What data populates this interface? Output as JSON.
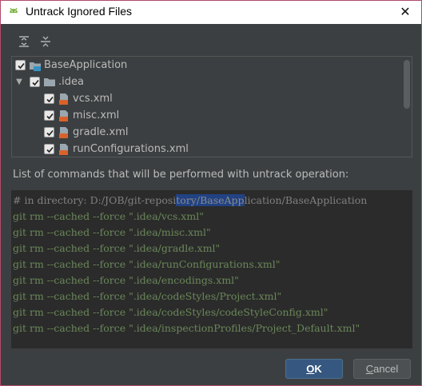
{
  "window": {
    "title": "Untrack Ignored Files",
    "close_glyph": "✕",
    "icon": "android-icon"
  },
  "toolbar": {
    "expand_all_icon": "expand-all-icon",
    "collapse_all_icon": "collapse-all-icon"
  },
  "tree": {
    "items": [
      {
        "label": "BaseApplication",
        "checked": true,
        "icon": "module-icon",
        "level": 0,
        "expanded": null
      },
      {
        "label": ".idea",
        "checked": true,
        "icon": "folder-icon",
        "level": 1,
        "expanded": true
      },
      {
        "label": "vcs.xml",
        "checked": true,
        "icon": "xml-file-icon",
        "level": 2,
        "expanded": null
      },
      {
        "label": "misc.xml",
        "checked": true,
        "icon": "xml-file-icon",
        "level": 2,
        "expanded": null
      },
      {
        "label": "gradle.xml",
        "checked": true,
        "icon": "xml-file-icon",
        "level": 2,
        "expanded": null
      },
      {
        "label": "runConfigurations.xml",
        "checked": true,
        "icon": "xml-file-icon",
        "level": 2,
        "expanded": null
      }
    ]
  },
  "commands": {
    "label": "List of commands that will be performed with untrack operation:",
    "comment_prefix": "# in directory: D:/JOB/git-reposi",
    "comment_highlight": "tory/BaseApp",
    "comment_suffix": "lication/BaseApplication",
    "lines": [
      "git rm --cached --force \".idea/vcs.xml\"",
      "git rm --cached --force \".idea/misc.xml\"",
      "git rm --cached --force \".idea/gradle.xml\"",
      "git rm --cached --force \".idea/runConfigurations.xml\"",
      "git rm --cached --force \".idea/encodings.xml\"",
      "git rm --cached --force \".idea/codeStyles/Project.xml\"",
      "git rm --cached --force \".idea/codeStyles/codeStyleConfig.xml\"",
      "git rm --cached --force \".idea/inspectionProfiles/Project_Default.xml\""
    ]
  },
  "buttons": {
    "ok_mnemonic": "O",
    "ok_rest": "K",
    "cancel_mnemonic": "C",
    "cancel_rest": "ancel"
  },
  "colors": {
    "background": "#3c3f41",
    "console_bg": "#2b2b2b",
    "command_text": "#6a8759",
    "comment_text": "#808080",
    "selection": "#214283",
    "ok_button": "#365880"
  }
}
